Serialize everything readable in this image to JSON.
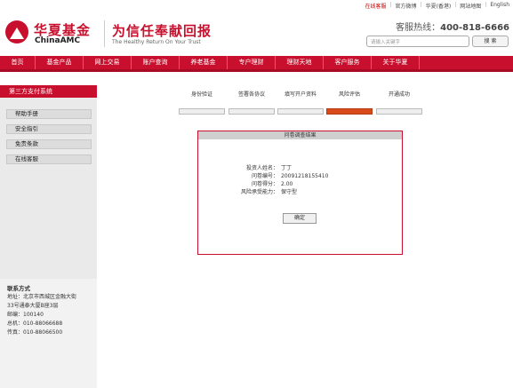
{
  "top_links": {
    "home": "在线客服",
    "official_weibo": "官方微博",
    "hk": "华夏(香港)",
    "sitemap": "网站地图",
    "english": "English"
  },
  "brand": {
    "logo_cn": "华夏基金",
    "logo_en": "ChinaAMC",
    "slogan_cn": "为信任奉献回报",
    "slogan_en": "The Healthy Return On Your Trust"
  },
  "hotline": {
    "label": "客服热线：",
    "number": "400-818-6666"
  },
  "search": {
    "placeholder": "请输入关键字",
    "button": "搜 索"
  },
  "nav": [
    "首页",
    "基金产品",
    "网上交易",
    "账户查询",
    "养老基金",
    "专户理财",
    "理财天地",
    "客户服务",
    "关于华夏"
  ],
  "sidebar": {
    "title": "第三方支付系统",
    "items": [
      "帮助手册",
      "安全指引",
      "免责条款",
      "在线客服"
    ],
    "contact": {
      "title": "联系方式",
      "address_1": "地址：北京市西城区金融大街",
      "address_2": "33号通泰大厦B座3层",
      "postcode": "邮编：100140",
      "phone": "总机：010-88066688",
      "fax": "传真：010-88066500"
    }
  },
  "steps": [
    "身份验证",
    "签署各协议",
    "填写开户资料",
    "风险评估",
    "开通成功"
  ],
  "active_step": 3,
  "result_panel": {
    "title": "问卷调查结果",
    "investor_name_label": "投资人姓名：",
    "investor_name": "丁丁",
    "questionnaire_no_label": "问卷编号：",
    "questionnaire_no": "20091218155410",
    "score_label": "问卷得分：",
    "score": "2.00",
    "risk_label": "风险承受能力：",
    "risk": "保守型",
    "confirm": "确定"
  },
  "colors": {
    "brand_red": "#c8102e",
    "active_step": "#d94a1a"
  }
}
